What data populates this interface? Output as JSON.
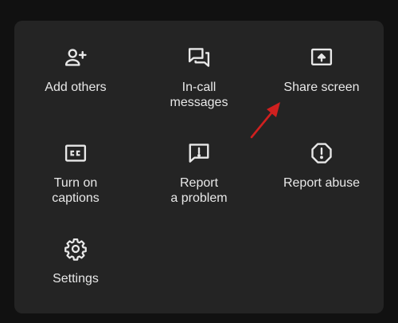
{
  "menu": {
    "items": [
      {
        "label": "Add others",
        "icon": "add-person-icon"
      },
      {
        "label": "In-call\nmessages",
        "icon": "chat-icon"
      },
      {
        "label": "Share screen",
        "icon": "present-screen-icon"
      },
      {
        "label": "Turn on\ncaptions",
        "icon": "closed-captions-icon"
      },
      {
        "label": "Report\na problem",
        "icon": "report-problem-icon"
      },
      {
        "label": "Report abuse",
        "icon": "report-abuse-icon"
      },
      {
        "label": "Settings",
        "icon": "gear-icon"
      }
    ]
  },
  "colors": {
    "background": "#111111",
    "panel": "#242424",
    "text": "#e8e8e8",
    "arrow": "#d0201f"
  }
}
